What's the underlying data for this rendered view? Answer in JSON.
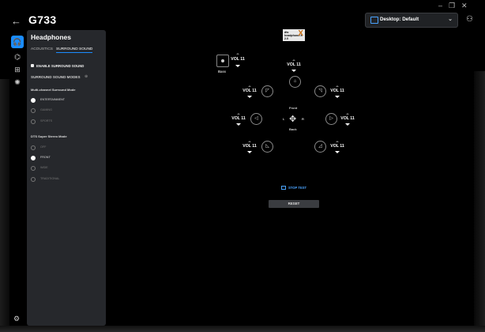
{
  "window": {
    "title": "G733",
    "controls": [
      "–",
      "❐",
      "✕"
    ],
    "profile_label": "Desktop: Default"
  },
  "rail": {
    "items": [
      "headphones-icon",
      "lighting-icon",
      "equalizer-icon",
      "sensor-icon"
    ]
  },
  "panel": {
    "title": "Headphones",
    "tabs": [
      "ACOUSTICS",
      "SURROUND SOUND"
    ],
    "active_tab": "SURROUND SOUND",
    "enable_label": "ENABLE SURROUND SOUND",
    "modes_header": "SURROUND SOUND MODES",
    "multichannel_title": "Multi-channel Surround Mode",
    "multichannel_options": [
      "ENTERTAINMENT",
      "GAMING",
      "SPORTS"
    ],
    "multichannel_selected": 0,
    "stereo_title": "DTS Super Stereo Mode",
    "stereo_options": [
      "OFF",
      "FRONT",
      "WIDE",
      "TRADITIONAL"
    ],
    "stereo_selected": 1
  },
  "main": {
    "badge_text": "dts headphone:X 2.0",
    "bass_label": "Bass",
    "front_label": "Front",
    "back_label": "Back",
    "left_label": "L",
    "right_label": "R",
    "stop_test_label": "STOP TEST",
    "reset_label": "RESET",
    "channels": {
      "bass": "VOL 11",
      "center": "VOL 11",
      "front_left": "VOL 11",
      "front_right": "VOL 11",
      "side_left": "VOL 11",
      "side_right": "VOL 11",
      "rear_left": "VOL 11",
      "rear_right": "VOL 11"
    }
  },
  "colors": {
    "accent": "#1a8cff",
    "panel_bg": "#26282c",
    "app_bg": "#000000"
  }
}
